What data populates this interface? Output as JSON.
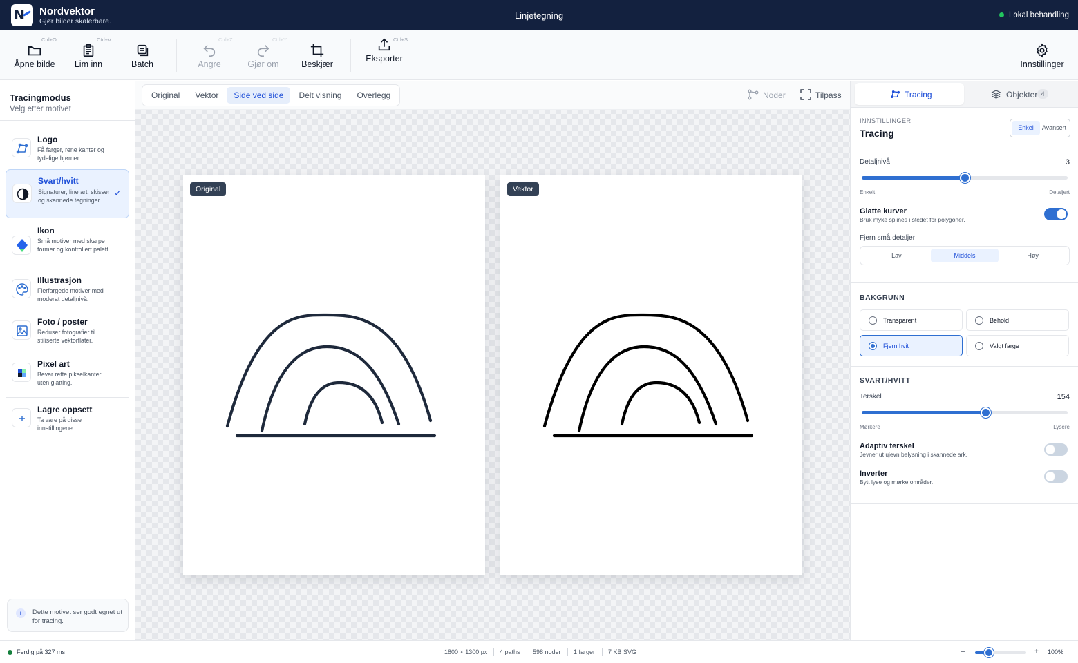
{
  "app": {
    "name": "Nordvektor",
    "tagline": "Gjør bilder skalerbare.",
    "document_title": "Linjetegning",
    "status": "Lokal behandling",
    "colors": {
      "header": "#13213f",
      "accent": "#2f6fd1",
      "status_ok": "#22c55e"
    }
  },
  "toolbar": {
    "open": {
      "label": "Åpne bilde",
      "shortcut": "Ctrl+O",
      "icon": "folder-icon"
    },
    "paste": {
      "label": "Lim inn",
      "shortcut": "Ctrl+V",
      "icon": "clipboard-icon"
    },
    "batch": {
      "label": "Batch",
      "icon": "batch-icon"
    },
    "undo": {
      "label": "Angre",
      "shortcut": "Ctrl+Z",
      "icon": "undo-icon"
    },
    "redo": {
      "label": "Gjør om",
      "shortcut": "Ctrl+Y",
      "icon": "redo-icon"
    },
    "crop": {
      "label": "Beskjær",
      "icon": "crop-icon"
    },
    "export": {
      "label": "Eksporter",
      "shortcut": "Ctrl+S",
      "icon": "export-icon"
    },
    "settings": {
      "label": "Innstillinger",
      "icon": "gear-icon"
    }
  },
  "sidebar": {
    "title": "Tracingmodus",
    "subtitle": "Velg etter motivet",
    "modes": [
      {
        "title": "Logo",
        "desc": "Få farger, rene kanter og tydelige hjørner.",
        "icon": "logo-mode-icon"
      },
      {
        "title": "Svart/hvitt",
        "desc": "Signaturer, line art, skisser og skannede tegninger.",
        "icon": "contrast-icon",
        "selected": true
      },
      {
        "title": "Ikon",
        "desc": "Små motiver med skarpe former og kontrollert palett.",
        "icon": "diamond-icon"
      },
      {
        "title": "Illustrasjon",
        "desc": "Flerfargede motiver med moderat detaljnivå.",
        "icon": "palette-icon"
      },
      {
        "title": "Foto / poster",
        "desc": "Reduser fotografier til stiliserte vektorflater.",
        "icon": "image-icon"
      },
      {
        "title": "Pixel art",
        "desc": "Bevar rette pikselkanter uten glatting.",
        "icon": "pixel-icon"
      }
    ],
    "save_preset": {
      "title": "Lagre oppsett",
      "desc": "Ta vare på disse innstillingene",
      "icon": "plus-icon"
    },
    "hint": "Dette motivet ser godt egnet ut for tracing."
  },
  "canvas": {
    "view_modes": [
      "Original",
      "Vektor",
      "Side ved side",
      "Delt visning",
      "Overlegg"
    ],
    "active_view": "Side ved side",
    "nodes_label": "Noder",
    "fit_label": "Tilpass",
    "original_tag": "Original",
    "vector_tag": "Vektor"
  },
  "panel": {
    "tabs": {
      "tracing": "Tracing",
      "objects": "Objekter",
      "objects_count": "4"
    },
    "eyebrow": "INNSTILLINGER",
    "title": "Tracing",
    "mode_simple": "Enkel",
    "mode_advanced": "Avansert",
    "detail": {
      "label": "Detaljnivå",
      "value": "3",
      "fraction": 0.5,
      "min_label": "Enkelt",
      "max_label": "Detaljert"
    },
    "smooth": {
      "title": "Glatte kurver",
      "desc": "Bruk myke splines i stedet for polygoner.",
      "on": true
    },
    "remove_small": {
      "label": "Fjern små detaljer",
      "options": [
        "Lav",
        "Middels",
        "Høy"
      ],
      "selected": "Middels"
    },
    "background": {
      "heading": "BAKGRUNN",
      "options": [
        "Transparent",
        "Behold",
        "Fjern hvit",
        "Valgt farge"
      ],
      "selected": "Fjern hvit"
    },
    "bw": {
      "heading": "SVART/HVITT",
      "threshold": {
        "label": "Terskel",
        "value": "154",
        "fraction": 0.604,
        "min_label": "Mørkere",
        "max_label": "Lysere"
      },
      "adaptive": {
        "title": "Adaptiv terskel",
        "desc": "Jevner ut ujevn belysning i skannede ark.",
        "on": false
      },
      "invert": {
        "title": "Inverter",
        "desc": "Bytt lyse og mørke områder.",
        "on": false
      }
    }
  },
  "statusbar": {
    "status": "Ferdig på 327 ms",
    "dimensions": "1800 × 1300 px",
    "paths": "4 paths",
    "nodes": "598 noder",
    "colors": "1 farger",
    "size": "7 KB SVG",
    "zoom_minus": "–",
    "zoom_plus": "+",
    "zoom": "100%",
    "zoom_fraction": 0.27
  }
}
